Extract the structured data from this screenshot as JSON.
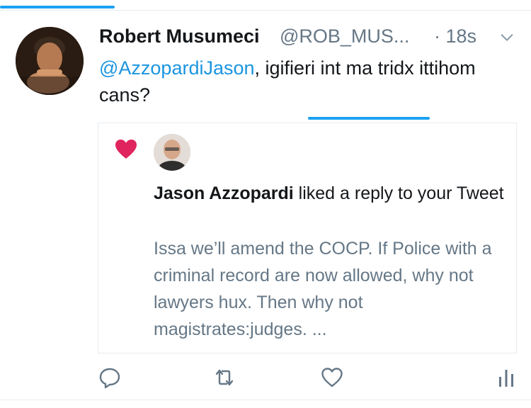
{
  "tweet": {
    "author_name": "Robert Musumeci",
    "author_handle": "@ROB_MUS...",
    "timestamp": "· 18s",
    "mention": "@AzzopardiJason",
    "text_rest": ", igifieri int ma tridx ittihom cans?"
  },
  "notification": {
    "liker_name": "Jason Azzopardi",
    "action_text": " liked a reply to your Tweet",
    "quoted_text": "Issa we’ll amend the COCP. If Police with a criminal record are now allowed, why not lawyers hux. Then why not magistrates:judges. ..."
  },
  "icons": {
    "menu": "chevron-down-icon",
    "like_notification": "heart-icon",
    "reply": "reply-icon",
    "retweet": "retweet-icon",
    "like": "like-icon",
    "analytics": "analytics-icon"
  },
  "colors": {
    "accent": "#1da1f2",
    "mention": "#1b95e0",
    "heart": "#e0245e",
    "secondary_text": "#657786"
  }
}
